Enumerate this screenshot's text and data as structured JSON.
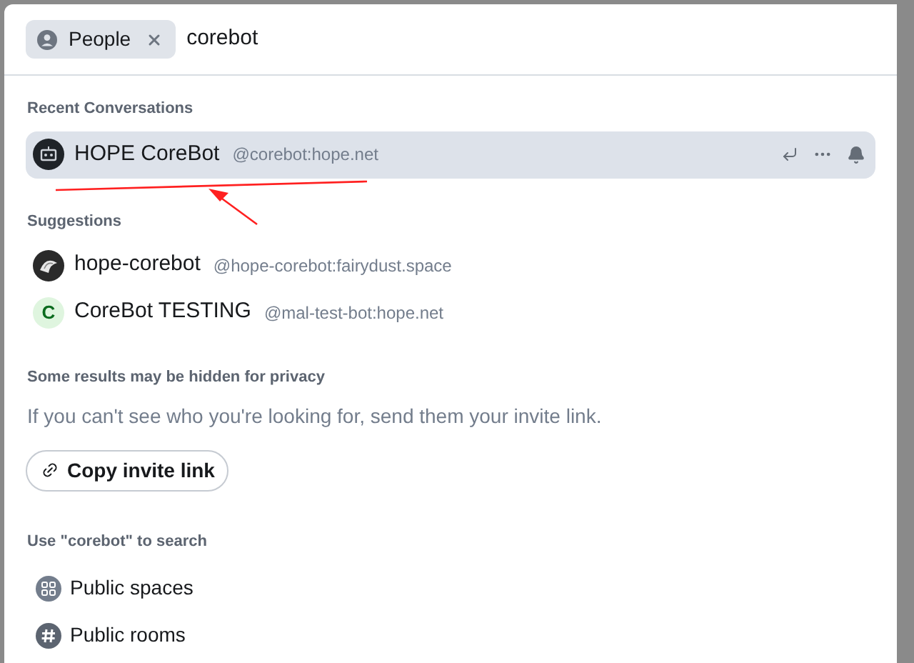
{
  "search": {
    "filter_chip": "People",
    "value": "corebot"
  },
  "recent": {
    "heading": "Recent Conversations",
    "items": [
      {
        "name": "HOPE CoreBot",
        "id": "@corebot:hope.net",
        "kind": "robot",
        "selected": true
      }
    ]
  },
  "suggestions": {
    "heading": "Suggestions",
    "items": [
      {
        "name": "hope-corebot",
        "id": "@hope-corebot:fairydust.space",
        "kind": "image",
        "selected": false
      },
      {
        "name": "CoreBot TESTING",
        "id": "@mal-test-bot:hope.net",
        "kind": "letter",
        "letter": "C",
        "selected": false
      }
    ]
  },
  "privacy": {
    "heading": "Some results may be hidden for privacy",
    "message": "If you can't see who you're looking for, send them your invite link.",
    "button": "Copy invite link"
  },
  "search_other": {
    "heading": "Use \"corebot\" to search",
    "items": [
      {
        "label": "Public spaces",
        "kind": "spaces"
      },
      {
        "label": "Public rooms",
        "kind": "rooms"
      }
    ]
  }
}
